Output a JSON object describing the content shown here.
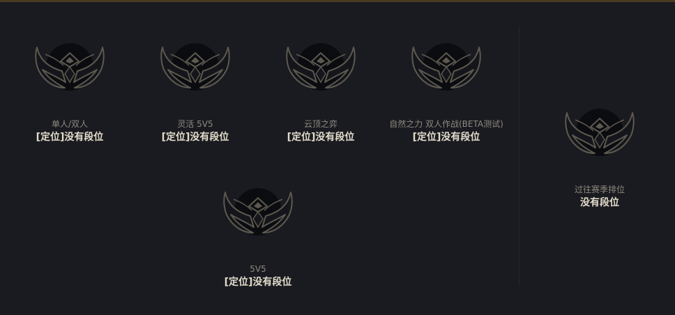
{
  "ranks": [
    {
      "queue": "单人/双人",
      "rank": "[定位]没有段位"
    },
    {
      "queue": "灵活 5V5",
      "rank": "[定位]没有段位"
    },
    {
      "queue": "云顶之弈",
      "rank": "[定位]没有段位"
    },
    {
      "queue": "自然之力 双人作战(BETA测试)",
      "rank": "[定位]没有段位"
    },
    {
      "queue": "5V5",
      "rank": "[定位]没有段位"
    }
  ],
  "past_season": {
    "queue": "过往赛季排位",
    "rank": "没有段位"
  },
  "icons": {
    "emblem": "unranked-emblem-icon"
  },
  "colors": {
    "background": "#1a1b20",
    "emblem_outline": "#5d5950",
    "emblem_fill": "#0b0c10",
    "queue_text": "#8f8a80",
    "rank_text": "#e3dccb"
  }
}
